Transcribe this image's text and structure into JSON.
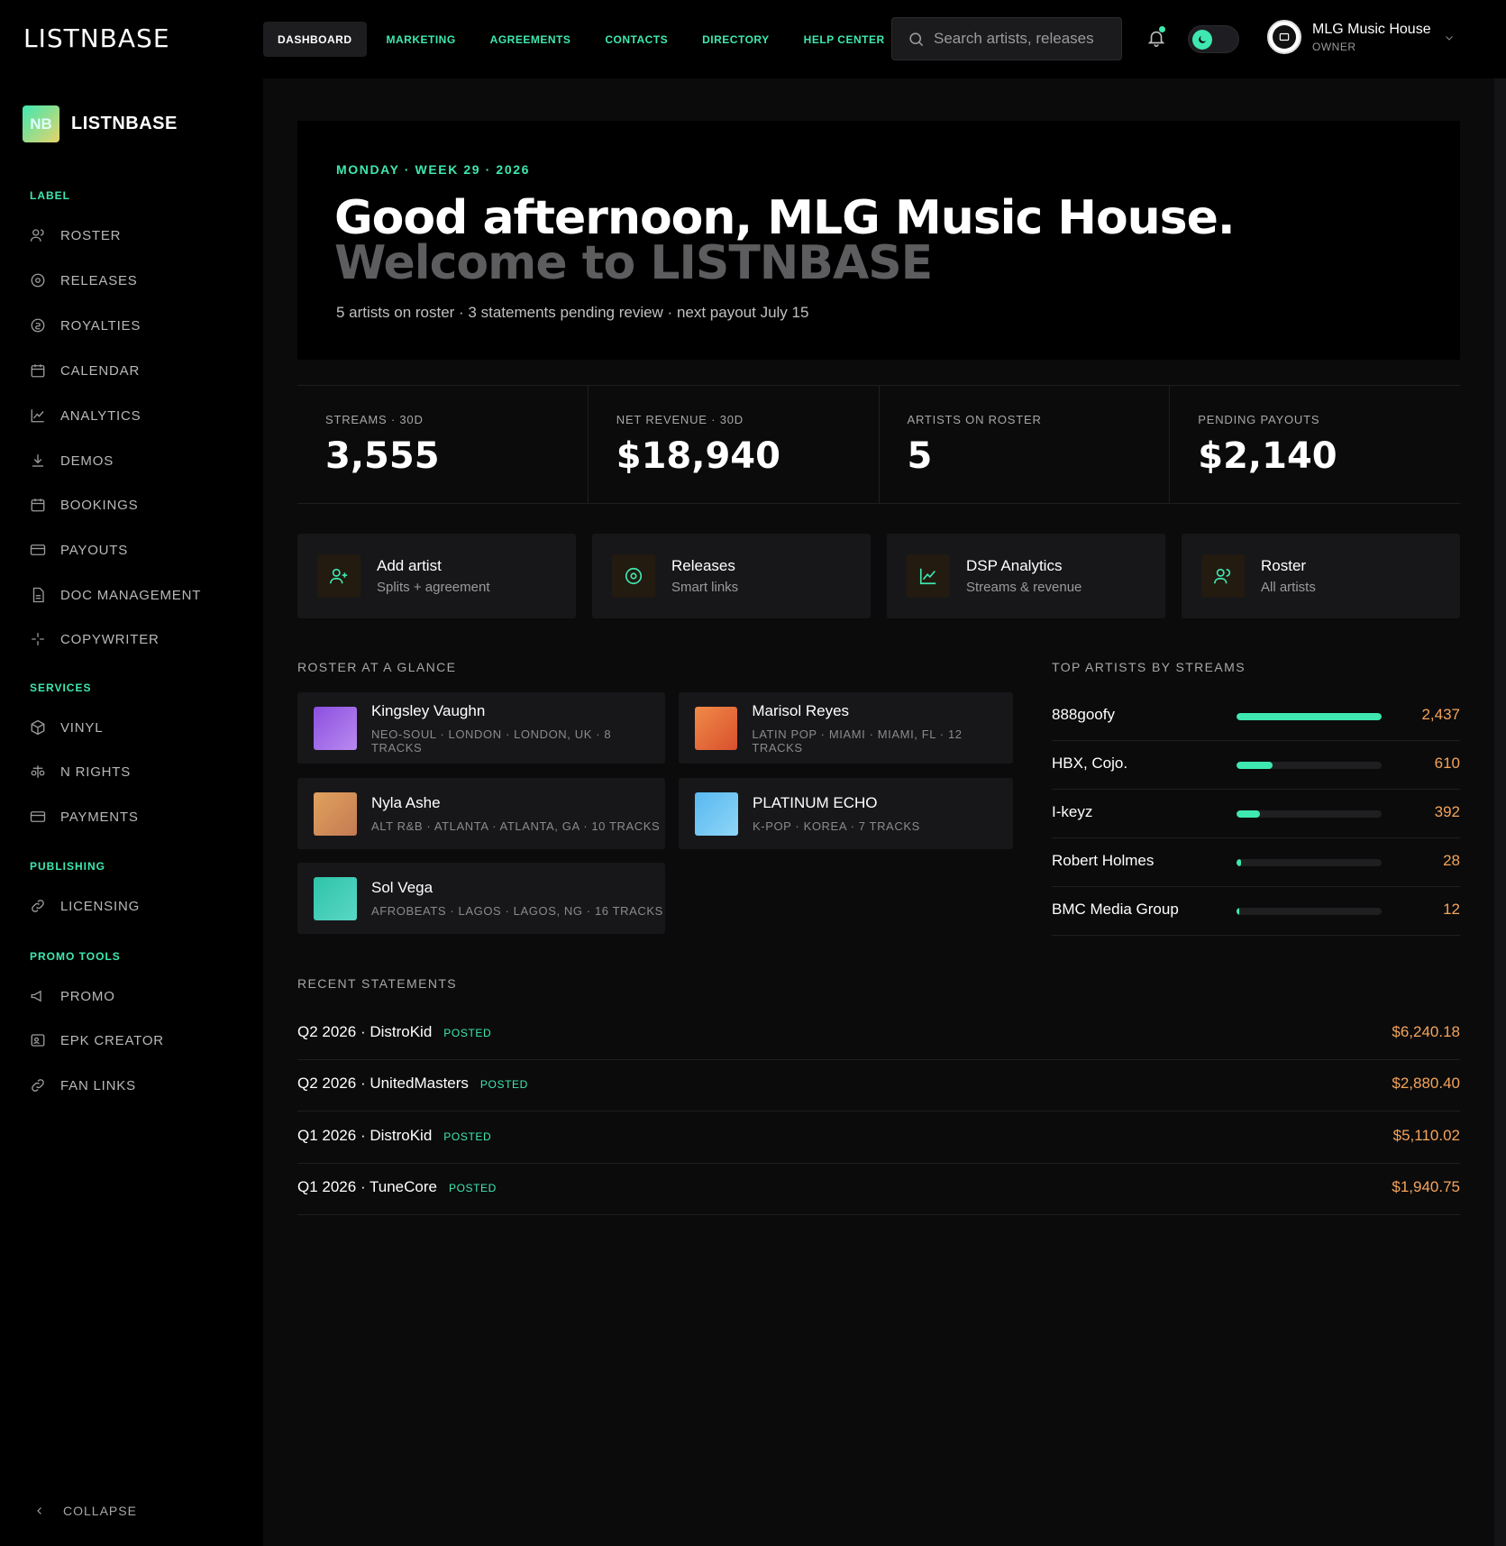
{
  "brand": "LISTNBASE",
  "topnav": [
    "DASHBOARD",
    "MARKETING",
    "AGREEMENTS",
    "CONTACTS",
    "DIRECTORY",
    "HELP CENTER"
  ],
  "search": {
    "placeholder": "Search artists, releases"
  },
  "user": {
    "name": "MLG Music House",
    "role": "OWNER"
  },
  "sidebar": {
    "brand_badge": "NB",
    "brand_text": "LISTNBASE",
    "sections": [
      {
        "label": "LABEL",
        "items": [
          "ROSTER",
          "RELEASES",
          "ROYALTIES",
          "CALENDAR",
          "ANALYTICS",
          "DEMOS",
          "BOOKINGS",
          "PAYOUTS",
          "DOC MANAGEMENT",
          "COPYWRITER"
        ]
      },
      {
        "label": "SERVICES",
        "items": [
          "VINYL",
          "N RIGHTS",
          "PAYMENTS"
        ]
      },
      {
        "label": "PUBLISHING",
        "items": [
          "LICENSING"
        ]
      },
      {
        "label": "PROMO TOOLS",
        "items": [
          "PROMO",
          "EPK CREATOR",
          "FAN LINKS"
        ]
      }
    ],
    "collapse": "COLLAPSE"
  },
  "hero": {
    "date": "MONDAY · WEEK 29 · 2026",
    "greeting": "Good afternoon, MLG Music House.",
    "welcome": "Welcome to LISTNBASE",
    "summary": "5 artists on roster · 3 statements pending review · next payout July 15"
  },
  "stats": [
    {
      "label": "STREAMS · 30D",
      "value": "3,555"
    },
    {
      "label": "NET REVENUE · 30D",
      "value": "$18,940"
    },
    {
      "label": "ARTISTS ON ROSTER",
      "value": "5"
    },
    {
      "label": "PENDING PAYOUTS",
      "value": "$2,140"
    }
  ],
  "actions": [
    {
      "title": "Add artist",
      "sub": "Splits + agreement",
      "icon": "user-plus-icon"
    },
    {
      "title": "Releases",
      "sub": "Smart links",
      "icon": "disc-icon"
    },
    {
      "title": "DSP Analytics",
      "sub": "Streams & revenue",
      "icon": "chart-line-icon"
    },
    {
      "title": "Roster",
      "sub": "All artists",
      "icon": "users-icon"
    }
  ],
  "roster": {
    "heading": "ROSTER AT A GLANCE",
    "artists": [
      {
        "name": "Kingsley Vaughn",
        "meta": "NEO-SOUL · LONDON · LONDON, UK · 8 TRACKS",
        "colors": [
          "#8b4fe0",
          "#b98af0"
        ]
      },
      {
        "name": "Marisol Reyes",
        "meta": "LATIN POP · MIAMI · MIAMI, FL · 12 TRACKS",
        "colors": [
          "#f08a48",
          "#d9502e"
        ]
      },
      {
        "name": "Nyla Ashe",
        "meta": "ALT R&B · ATLANTA · ATLANTA, GA · 10 TRACKS",
        "colors": [
          "#e0a25e",
          "#c47a52"
        ]
      },
      {
        "name": "PLATINUM ECHO",
        "meta": "K-POP · KOREA · 7 TRACKS",
        "colors": [
          "#58b8f0",
          "#8fd6f7"
        ]
      },
      {
        "name": "Sol Vega",
        "meta": "AFROBEATS · LAGOS · LAGOS, NG · 16 TRACKS",
        "colors": [
          "#2ec4a8",
          "#5ad6c6"
        ]
      }
    ]
  },
  "top_artists": {
    "heading": "TOP ARTISTS BY STREAMS",
    "rows": [
      {
        "name": "888goofy",
        "streams": "2,437",
        "share": 1.0
      },
      {
        "name": "HBX, Cojo.",
        "streams": "610",
        "share": 0.25
      },
      {
        "name": "I-keyz",
        "streams": "392",
        "share": 0.16
      },
      {
        "name": "Robert Holmes",
        "streams": "28",
        "share": 0.03
      },
      {
        "name": "BMC Media Group",
        "streams": "12",
        "share": 0.01
      }
    ]
  },
  "statements": {
    "heading": "RECENT STATEMENTS",
    "rows": [
      {
        "name": "Q2 2026 · DistroKid",
        "status": "POSTED",
        "amount": "$6,240.18"
      },
      {
        "name": "Q2 2026 · UnitedMasters",
        "status": "POSTED",
        "amount": "$2,880.40"
      },
      {
        "name": "Q1 2026 · DistroKid",
        "status": "POSTED",
        "amount": "$5,110.02"
      },
      {
        "name": "Q1 2026 · TuneCore",
        "status": "POSTED",
        "amount": "$1,940.75"
      }
    ]
  },
  "colors": {
    "accent": "#3ee8b0",
    "amount": "#f5a45a",
    "background": "#0b0b0c",
    "card": "#17171a"
  }
}
